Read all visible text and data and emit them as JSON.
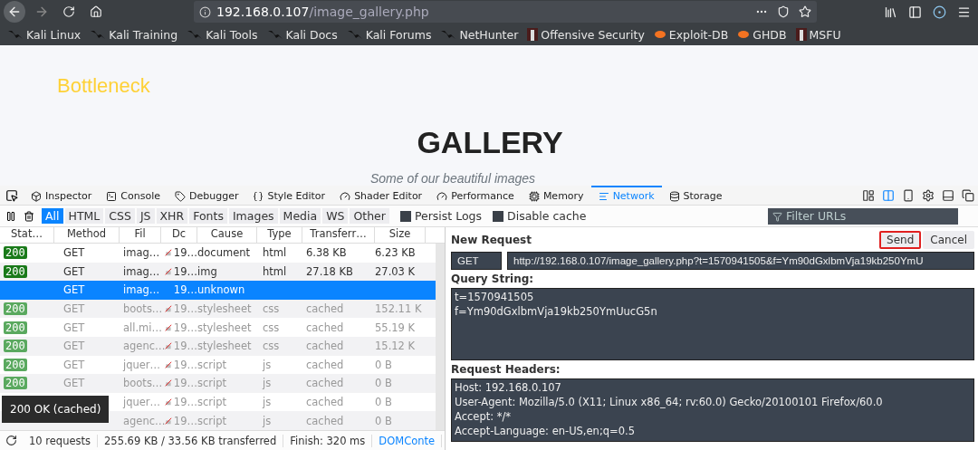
{
  "browser": {
    "back_enabled": true,
    "forward_enabled": false,
    "url": {
      "host": "192.168.0.107",
      "path": "/image_gallery.php"
    },
    "bookmarks": [
      {
        "label": "Kali Linux",
        "kind": "kali"
      },
      {
        "label": "Kali Training",
        "kind": "kali"
      },
      {
        "label": "Kali Tools",
        "kind": "kali"
      },
      {
        "label": "Kali Docs",
        "kind": "kali"
      },
      {
        "label": "Kali Forums",
        "kind": "kali"
      },
      {
        "label": "NetHunter",
        "kind": "kali"
      },
      {
        "label": "Offensive Security",
        "kind": "offsec"
      },
      {
        "label": "Exploit-DB",
        "kind": "exploit"
      },
      {
        "label": "GHDB",
        "kind": "exploit"
      },
      {
        "label": "MSFU",
        "kind": "offsec"
      }
    ]
  },
  "page": {
    "brand": "Bottleneck",
    "heading": "GALLERY",
    "subheading": "Some of our beautiful images"
  },
  "devtools": {
    "tabs": [
      {
        "label": "Inspector",
        "selected": false
      },
      {
        "label": "Console",
        "selected": false
      },
      {
        "label": "Debugger",
        "selected": false
      },
      {
        "label": "Style Editor",
        "selected": false
      },
      {
        "label": "Shader Editor",
        "selected": false
      },
      {
        "label": "Performance",
        "selected": false
      },
      {
        "label": "Memory",
        "selected": false
      },
      {
        "label": "Network",
        "selected": true
      },
      {
        "label": "Storage",
        "selected": false
      }
    ],
    "filters": [
      {
        "label": "All",
        "selected": true
      },
      {
        "label": "HTML",
        "selected": false
      },
      {
        "label": "CSS",
        "selected": false
      },
      {
        "label": "JS",
        "selected": false
      },
      {
        "label": "XHR",
        "selected": false
      },
      {
        "label": "Fonts",
        "selected": false
      },
      {
        "label": "Images",
        "selected": false
      },
      {
        "label": "Media",
        "selected": false
      },
      {
        "label": "WS",
        "selected": false
      },
      {
        "label": "Other",
        "selected": false
      }
    ],
    "options": [
      {
        "label": "Persist Logs",
        "checked": false
      },
      {
        "label": "Disable cache",
        "checked": false
      }
    ],
    "filter_field": {
      "placeholder": "Filter URLs"
    },
    "table": {
      "columns": [
        "Stat…",
        "Method",
        "Fil",
        "Dc",
        "Cause",
        "Type",
        "Transferr…",
        "Size"
      ],
      "rows": [
        {
          "status": "200",
          "method": "GET",
          "file": "imag…",
          "insecure": true,
          "domain": "19…",
          "cause": "document",
          "type": "html",
          "transferred": "6.38 KB",
          "size": "6.23 KB",
          "cached": false,
          "selected": false
        },
        {
          "status": "200",
          "method": "GET",
          "file": "imag…",
          "insecure": true,
          "domain": "19…",
          "cause": "img",
          "type": "html",
          "transferred": "27.18 KB",
          "size": "27.03 K",
          "cached": false,
          "selected": false
        },
        {
          "method": "GET",
          "file": "imag…",
          "insecure": false,
          "domain": "19…",
          "cause": "unknown",
          "cached": false,
          "selected": true
        },
        {
          "status": "200",
          "method": "GET",
          "file": "boots…",
          "insecure": true,
          "domain": "19…",
          "cause": "stylesheet",
          "type": "css",
          "transferred": "cached",
          "size": "152.11 K",
          "cached": true,
          "selected": false
        },
        {
          "status": "200",
          "method": "GET",
          "file": "all.mi…",
          "insecure": true,
          "domain": "19…",
          "cause": "stylesheet",
          "type": "css",
          "transferred": "cached",
          "size": "55.19 K",
          "cached": true,
          "selected": false
        },
        {
          "status": "200",
          "method": "GET",
          "file": "agenc…",
          "insecure": true,
          "domain": "19…",
          "cause": "stylesheet",
          "type": "css",
          "transferred": "cached",
          "size": "15.12 K",
          "cached": true,
          "selected": false
        },
        {
          "status": "200",
          "method": "GET",
          "file": "jquer…",
          "insecure": true,
          "domain": "19…",
          "cause": "script",
          "type": "js",
          "transferred": "cached",
          "size": "0 B",
          "cached": true,
          "selected": false
        },
        {
          "status": "200",
          "method": "GET",
          "file": "boots…",
          "insecure": true,
          "domain": "19…",
          "cause": "script",
          "type": "js",
          "transferred": "cached",
          "size": "0 B",
          "cached": true,
          "selected": false
        },
        {
          "file": "jquer…",
          "insecure": true,
          "domain": "19…",
          "cause": "script",
          "type": "js",
          "transferred": "cached",
          "size": "0 B",
          "cached": true,
          "selected": false
        },
        {
          "file": "agenc…",
          "insecure": true,
          "domain": "19…",
          "cause": "script",
          "type": "js",
          "transferred": "cached",
          "size": "0 B",
          "cached": true,
          "selected": false
        }
      ]
    },
    "tooltip": "200 OK (cached)",
    "status_bar": {
      "requests": "10 requests",
      "size": "255.69 KB / 33.56 KB transferred",
      "finish": "Finish: 320 ms",
      "dom": "DOMConte"
    },
    "new_request": {
      "title": "New Request",
      "send": {
        "label": "Send",
        "highlighted": true
      },
      "cancel": "Cancel",
      "method": "GET",
      "url": "http://192.168.0.107/image_gallery.php?t=1570941505&f=Ym90dGxlbmVja19kb250YmU",
      "query_label": "Query String:",
      "query": [
        "t=1570941505",
        "f=Ym90dGxlbmVja19kb250YmUucG5n"
      ],
      "headers_label": "Request Headers:",
      "headers": [
        "Host: 192.168.0.107",
        "User-Agent: Mozilla/5.0 (X11; Linux x86_64; rv:60.0) Gecko/20100101 Firefox/60.0",
        "Accept: */*",
        "Accept-Language: en-US,en;q=0.5"
      ]
    }
  }
}
